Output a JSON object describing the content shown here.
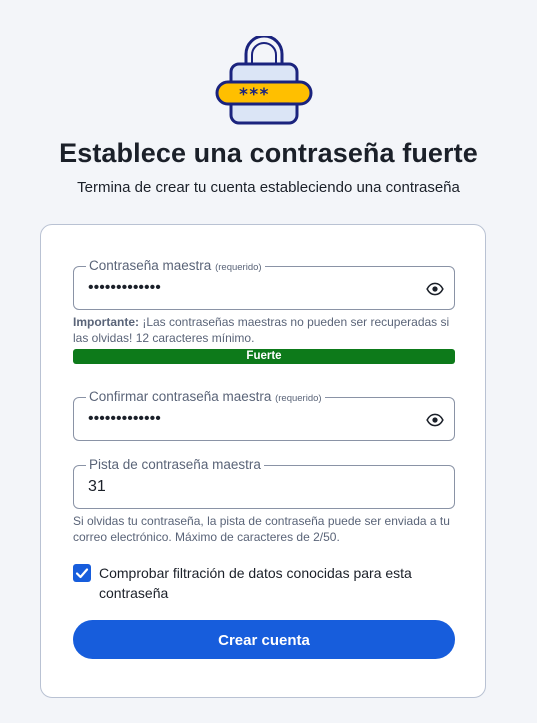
{
  "header": {
    "title": "Establece una contraseña fuerte",
    "subtitle": "Termina de crear tu cuenta estableciendo una contraseña",
    "illustration_text": "***__"
  },
  "form": {
    "master_password": {
      "label": "Contraseña maestra",
      "required": "(requerido)",
      "value": "•••••••••••••"
    },
    "important": {
      "bold": "Importante:",
      "text": " ¡Las contraseñas maestras no pueden ser recuperadas si las olvidas! 12 caracteres mínimo."
    },
    "strength": {
      "label": "Fuerte",
      "color": "#0d7a1a"
    },
    "confirm_password": {
      "label": "Confirmar contraseña maestra",
      "required": "(requerido)",
      "value": "•••••••••••••"
    },
    "hint": {
      "label": "Pista de contraseña maestra",
      "value": "31",
      "helper": "Si olvidas tu contraseña, la pista de contraseña puede ser enviada a tu correo electrónico. Máximo de caracteres de 2/50."
    },
    "breach_check": {
      "label": "Comprobar filtración de datos conocidas para esta contraseña",
      "checked": true
    },
    "submit_label": "Crear cuenta"
  },
  "colors": {
    "accent": "#175ddc",
    "success": "#0d7a1a",
    "illustration_yellow": "#ffbf00",
    "illustration_blue": "#1a237e"
  },
  "icons": [
    "lock-password-illustration",
    "eye-icon",
    "checkmark-icon"
  ]
}
